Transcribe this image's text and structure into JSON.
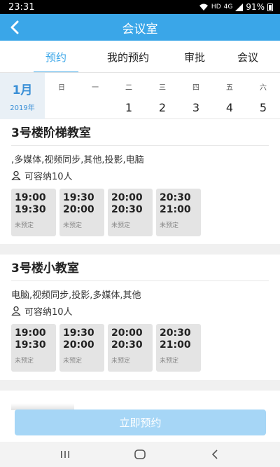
{
  "status_bar": {
    "time": "23:31",
    "network": "HD",
    "signal": "4G",
    "battery": "91%"
  },
  "app_bar": {
    "title": "会议室"
  },
  "tabs": [
    {
      "label": "预约",
      "active": true
    },
    {
      "label": "我的预约",
      "active": false
    },
    {
      "label": "审批",
      "active": false
    },
    {
      "label": "会议",
      "active": false
    }
  ],
  "calendar": {
    "month": "1月",
    "year": "2019年",
    "days": [
      {
        "weekday": "日",
        "date": ""
      },
      {
        "weekday": "一",
        "date": ""
      },
      {
        "weekday": "二",
        "date": "1"
      },
      {
        "weekday": "三",
        "date": "2"
      },
      {
        "weekday": "四",
        "date": "3"
      },
      {
        "weekday": "五",
        "date": "4"
      },
      {
        "weekday": "六",
        "date": "5"
      }
    ]
  },
  "rooms": [
    {
      "name": "3号楼阶梯教室",
      "facilities": ",多媒体,视频同步,其他,投影,电脑",
      "capacity": "可容纳10人",
      "slots": [
        {
          "start": "19:00",
          "end": "19:30",
          "status": "未预定"
        },
        {
          "start": "19:30",
          "end": "20:00",
          "status": "未预定"
        },
        {
          "start": "20:00",
          "end": "20:30",
          "status": "未预定"
        },
        {
          "start": "20:30",
          "end": "21:00",
          "status": "未预定"
        }
      ]
    },
    {
      "name": "3号楼小教室",
      "facilities": "电脑,视频同步,投影,多媒体,其他",
      "capacity": "可容纳10人",
      "slots": [
        {
          "start": "19:00",
          "end": "19:30",
          "status": "未预定"
        },
        {
          "start": "19:30",
          "end": "20:00",
          "status": "未预定"
        },
        {
          "start": "20:00",
          "end": "20:30",
          "status": "未预定"
        },
        {
          "start": "20:30",
          "end": "21:00",
          "status": "未预定"
        }
      ]
    }
  ],
  "book_button": {
    "label": "立即预约"
  },
  "colors": {
    "accent": "#3aa6e8",
    "button_disabled": "#a6d6f6",
    "slot_bg": "#e4e4e4"
  }
}
